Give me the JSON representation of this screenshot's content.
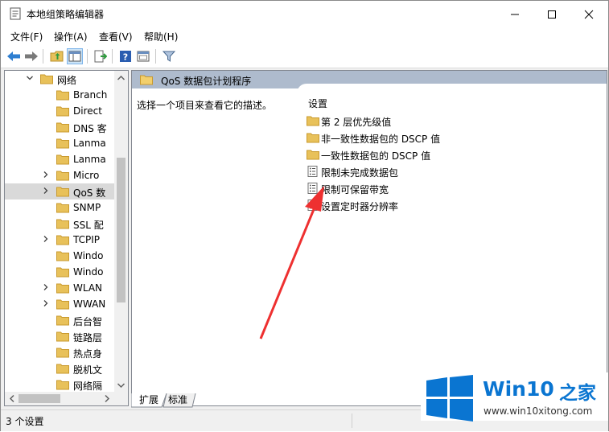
{
  "window": {
    "title": "本地组策略编辑器",
    "controls": [
      "minimize",
      "maximize",
      "close"
    ]
  },
  "menu": {
    "file": "文件(F)",
    "action": "操作(A)",
    "view": "查看(V)",
    "help": "帮助(H)"
  },
  "toolbar": {
    "icons": [
      "back-icon",
      "forward-icon",
      "up-folder-icon",
      "show-hide-tree-icon",
      "export-list-icon",
      "help-icon",
      "properties-icon",
      "filter-icon"
    ]
  },
  "tree": {
    "items": [
      {
        "label": "网络",
        "expander": "expanded",
        "level": 0
      },
      {
        "label": "Branch",
        "expander": "none",
        "level": 1
      },
      {
        "label": "Direct",
        "expander": "none",
        "level": 1
      },
      {
        "label": "DNS 客",
        "expander": "none",
        "level": 1
      },
      {
        "label": "Lanma",
        "expander": "none",
        "level": 1
      },
      {
        "label": "Lanma",
        "expander": "none",
        "level": 1
      },
      {
        "label": "Micro",
        "expander": "collapsed",
        "level": 1
      },
      {
        "label": "QoS 数",
        "expander": "collapsed",
        "level": 1,
        "selected": true
      },
      {
        "label": "SNMP",
        "expander": "none",
        "level": 1
      },
      {
        "label": "SSL 配",
        "expander": "none",
        "level": 1
      },
      {
        "label": "TCPIP",
        "expander": "collapsed",
        "level": 1
      },
      {
        "label": "Windo",
        "expander": "none",
        "level": 1
      },
      {
        "label": "Windo",
        "expander": "none",
        "level": 1
      },
      {
        "label": "WLAN",
        "expander": "collapsed",
        "level": 1
      },
      {
        "label": "WWAN",
        "expander": "collapsed",
        "level": 1
      },
      {
        "label": "后台智",
        "expander": "none",
        "level": 1
      },
      {
        "label": "链路层",
        "expander": "none",
        "level": 1
      },
      {
        "label": "热点身",
        "expander": "none",
        "level": 1
      },
      {
        "label": "脱机文",
        "expander": "none",
        "level": 1
      },
      {
        "label": "网络隔",
        "expander": "none",
        "level": 1
      }
    ]
  },
  "right_pane": {
    "header": "QoS 数据包计划程序",
    "description": "选择一个项目来查看它的描述。",
    "column_header": "设置",
    "settings": [
      {
        "label": "第 2 层优先级值",
        "icon": "folder-icon"
      },
      {
        "label": "非一致性数据包的 DSCP 值",
        "icon": "folder-icon"
      },
      {
        "label": "一致性数据包的 DSCP 值",
        "icon": "folder-icon"
      },
      {
        "label": "限制未完成数据包",
        "icon": "policy-setting-icon"
      },
      {
        "label": "限制可保留带宽",
        "icon": "policy-setting-icon"
      },
      {
        "label": "设置定时器分辨率",
        "icon": "policy-setting-icon"
      }
    ]
  },
  "tabs": {
    "extended": "扩展",
    "standard": "标准"
  },
  "status": {
    "text": "3 个设置"
  },
  "watermark": {
    "brand": "Win10",
    "brand_suffix": "之家",
    "url": "www.win10xitong.com"
  },
  "colors": {
    "folder": "#e8c15a",
    "arrow": "#ee3030",
    "accent_blue": "#0a75d1",
    "header_band": "#aebbcd"
  }
}
